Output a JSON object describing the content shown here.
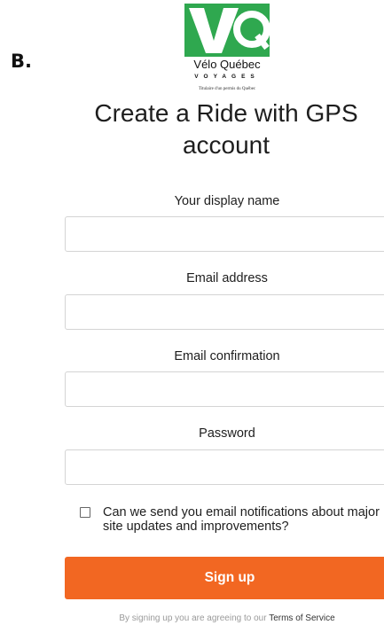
{
  "step": {
    "letter": "B."
  },
  "logo": {
    "mark_letters": "VQ",
    "brand": "Vélo Québec",
    "subtitle": "VOYAGES",
    "tagline": "Titulaire d'un permis du Québec",
    "color": "#2fa84f"
  },
  "page": {
    "title": "Create a Ride with GPS account"
  },
  "form": {
    "display_name": {
      "label": "Your display name",
      "value": ""
    },
    "email": {
      "label": "Email address",
      "value": ""
    },
    "email_confirmation": {
      "label": "Email confirmation",
      "value": ""
    },
    "password": {
      "label": "Password",
      "value": ""
    },
    "notifications": {
      "label": "Can we send you email notifications about major site updates and improvements?",
      "checked": false
    },
    "submit": {
      "label": "Sign up",
      "color": "#f26722"
    }
  },
  "footer": {
    "terms_prefix": "By signing up you are agreeing to our",
    "terms_link": "Terms of Service"
  }
}
